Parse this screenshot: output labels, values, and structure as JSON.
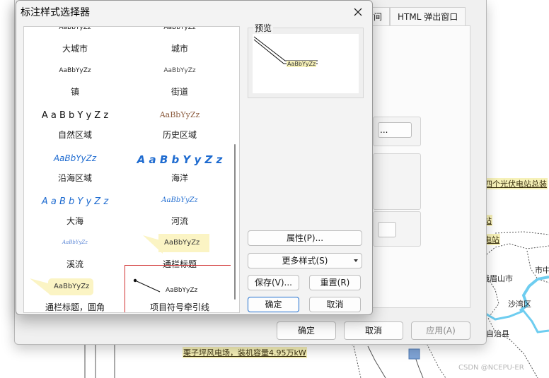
{
  "map": {
    "labels": {
      "pv": "县四个光伏电站总装",
      "station1": "电站",
      "station2": "伏电站",
      "city1": "峨眉山市",
      "city2": "市中",
      "district": "沙湾区",
      "county": "族自治县",
      "wind": "栗子坪风电场，装机容量4.95万kW"
    },
    "watermark": "CSDN @NCEPU-ER"
  },
  "background_dialog": {
    "tabs": {
      "partial": "时间",
      "html_popup": "HTML 弹出窗口"
    },
    "mini_button": "...",
    "ok_label": "确定",
    "cancel_label": "取消",
    "apply_label": "应用(A)"
  },
  "selector": {
    "title": "标注样式选择器",
    "sample_text": "AaBbYyZz",
    "sample_spaced": "A a B b Y y Z z",
    "styles": [
      {
        "label": "大城市"
      },
      {
        "label": "城市"
      },
      {
        "label": "镇"
      },
      {
        "label": "街道"
      },
      {
        "label": "自然区域"
      },
      {
        "label": "历史区域"
      },
      {
        "label": "沿海区域"
      },
      {
        "label": "海洋"
      },
      {
        "label": "大海"
      },
      {
        "label": "河流"
      },
      {
        "label": "溪流"
      },
      {
        "label": "通栏标题"
      },
      {
        "label": "通栏标题，圆角"
      },
      {
        "label": "项目符号牵引线"
      }
    ],
    "preview_label": "预览",
    "buttons": {
      "properties": "属性(P)...",
      "more_styles": "更多样式(S)",
      "save": "保存(V)...",
      "reset": "重置(R)",
      "ok": "确定",
      "cancel": "取消"
    },
    "colors": {
      "accent": "#1f6fcf",
      "selection": "#d03030",
      "callout": "#fbf4c4",
      "blue_text": "#1e6bd0",
      "history_text": "#8a5a3c"
    }
  }
}
